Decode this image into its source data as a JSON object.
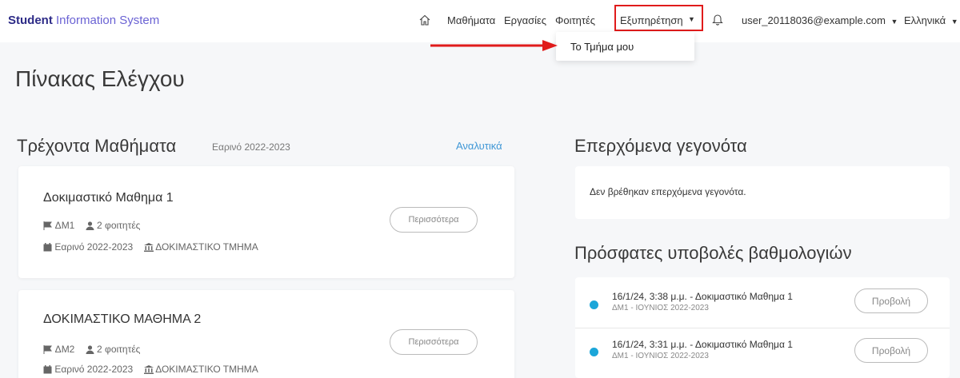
{
  "brand": {
    "part1": "Student",
    "part2": "Information System"
  },
  "nav": {
    "home_icon": "home-icon",
    "courses": "Μαθήματα",
    "assignments": "Εργασίες",
    "students": "Φοιτητές",
    "services": "Εξυπηρέτηση",
    "bell_icon": "bell-icon",
    "user": "user_20118036@example.com",
    "language": "Ελληνικά"
  },
  "services_menu": {
    "items": [
      "Το Τμήμα μου"
    ]
  },
  "page": {
    "title": "Πίνακας Ελέγχου"
  },
  "current_courses": {
    "title": "Τρέχοντα Μαθήματα",
    "subtitle": "Εαρινό 2022-2023",
    "details_link": "Αναλυτικά",
    "more_button": "Περισσότερα",
    "courses": [
      {
        "name": "Δοκιμαστικό Μαθημα 1",
        "code": "ΔΜ1",
        "students": "2 φοιτητές",
        "semester": "Εαρινό 2022-2023",
        "department": "ΔΟΚΙΜΑΣΤΙΚΟ ΤΜΗΜΑ"
      },
      {
        "name": "ΔΟΚΙΜΑΣΤΙΚΟ ΜΑΘΗΜΑ 2",
        "code": "ΔΜ2",
        "students": "2 φοιτητές",
        "semester": "Εαρινό 2022-2023",
        "department": "ΔΟΚΙΜΑΣΤΙΚΟ ΤΜΗΜΑ"
      }
    ]
  },
  "upcoming_events": {
    "title": "Επερχόμενα γεγονότα",
    "empty": "Δεν βρέθηκαν επερχόμενα γεγονότα."
  },
  "recent_submissions": {
    "title": "Πρόσφατες υποβολές βαθμολογιών",
    "view_button": "Προβολή",
    "items": [
      {
        "main": "16/1/24, 3:38 μ.μ. - Δοκιμαστικό Μαθημα 1",
        "secondary": "ΔΜ1 - ΙΟΥΝΙΟΣ 2022-2023"
      },
      {
        "main": "16/1/24, 3:31 μ.μ. - Δοκιμαστικό Μαθημα 1",
        "secondary": "ΔΜ1 - ΙΟΥΝΙΟΣ 2022-2023"
      }
    ]
  },
  "colors": {
    "brand": "#2d2b87",
    "accent": "#3f97d6",
    "highlight": "#e01b1b",
    "dot": "#1ba6d9"
  }
}
